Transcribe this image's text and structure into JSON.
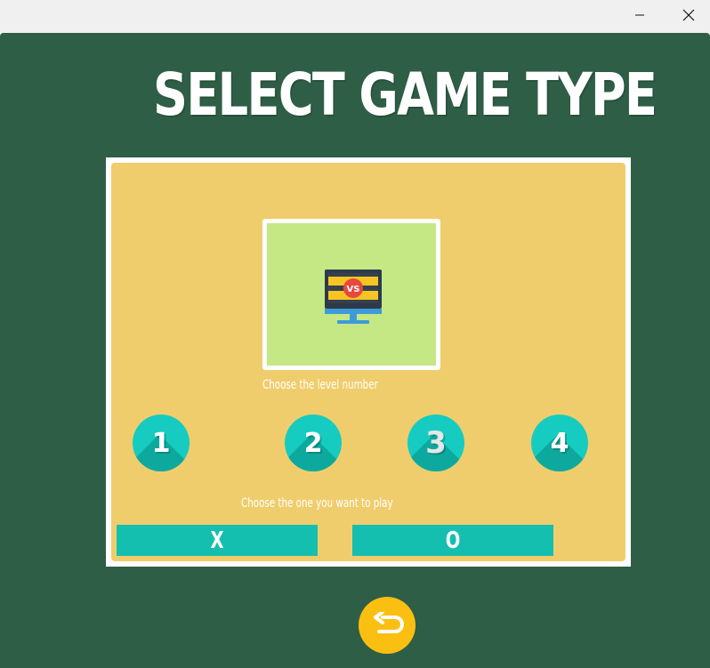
{
  "window": {
    "minimize_glyph": "—",
    "close_glyph": "✕"
  },
  "main": {
    "title": "SELECT GAME TYPE",
    "preview_icon": "vs-monitor-icon",
    "vs_badge": "VS",
    "level_prompt": "Choose the level number",
    "levels": [
      "1",
      "2",
      "3",
      "4"
    ],
    "player_prompt": "Choose the one you want to play",
    "choices": [
      "X",
      "O"
    ],
    "back_icon": "back-arrow-icon"
  },
  "colors": {
    "background": "#2f5e46",
    "panel": "#f0cd6c",
    "preview": "#c5e885",
    "accent_teal": "#16ccc0",
    "choice_bar": "#15bfb0",
    "back_button": "#fbbf12"
  }
}
